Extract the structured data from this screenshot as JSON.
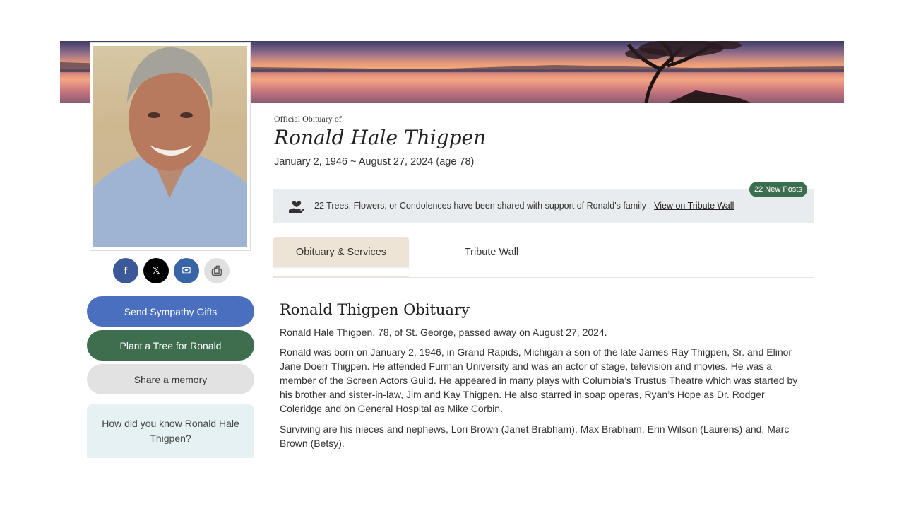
{
  "obituary_header": {
    "label": "Official Obituary of",
    "name": "Ronald Hale Thigpen",
    "dates": "January 2, 1946 ~ August 27, 2024 (age 78)"
  },
  "tribute": {
    "text": "22 Trees, Flowers, or Condolences have been shared with support of Ronald's family - ",
    "link": "View on Tribute Wall",
    "badge": "22 New Posts"
  },
  "tabs": [
    {
      "label": "Obituary & Services",
      "active": true
    },
    {
      "label": "Tribute Wall",
      "active": false
    }
  ],
  "social": {
    "facebook_glyph": "f",
    "x_glyph": "𝕏",
    "email_glyph": "✉",
    "print_glyph": "⎙"
  },
  "sidebar": {
    "gifts_button": "Send Sympathy Gifts",
    "tree_button": "Plant a Tree for Ronald",
    "share_button": "Share a memory",
    "know_question": "How did you know Ronald Hale Thigpen?"
  },
  "obituary": {
    "title": "Ronald Thigpen Obituary",
    "paragraphs": [
      "Ronald Hale Thigpen, 78, of St. George, passed away on August 27, 2024.",
      "Ronald was born on January 2, 1946, in Grand Rapids, Michigan a son of the late James Ray Thigpen, Sr. and Elinor Jane Doerr Thigpen.  He attended Furman University and was an actor of stage, television and movies.  He was a member of the Screen Actors Guild.  He appeared in many plays with Columbia’s Trustus Theatre which was started by his brother and sister-in-law, Jim and Kay Thigpen.  He also starred in soap operas, Ryan’s Hope as Dr. Rodger Coleridge and on General Hospital as Mike Corbin.",
      "Surviving are his nieces and nephews, Lori Brown (Janet Brabham), Max Brabham, Erin Wilson (Laurens) and, Marc Brown (Betsy)."
    ]
  },
  "colors": {
    "gifts_button": "#4a6fbe",
    "tree_button": "#3e6e4e",
    "share_button": "#e2e2e2",
    "active_tab": "#ede4d5",
    "badge": "#3b6e4e"
  }
}
